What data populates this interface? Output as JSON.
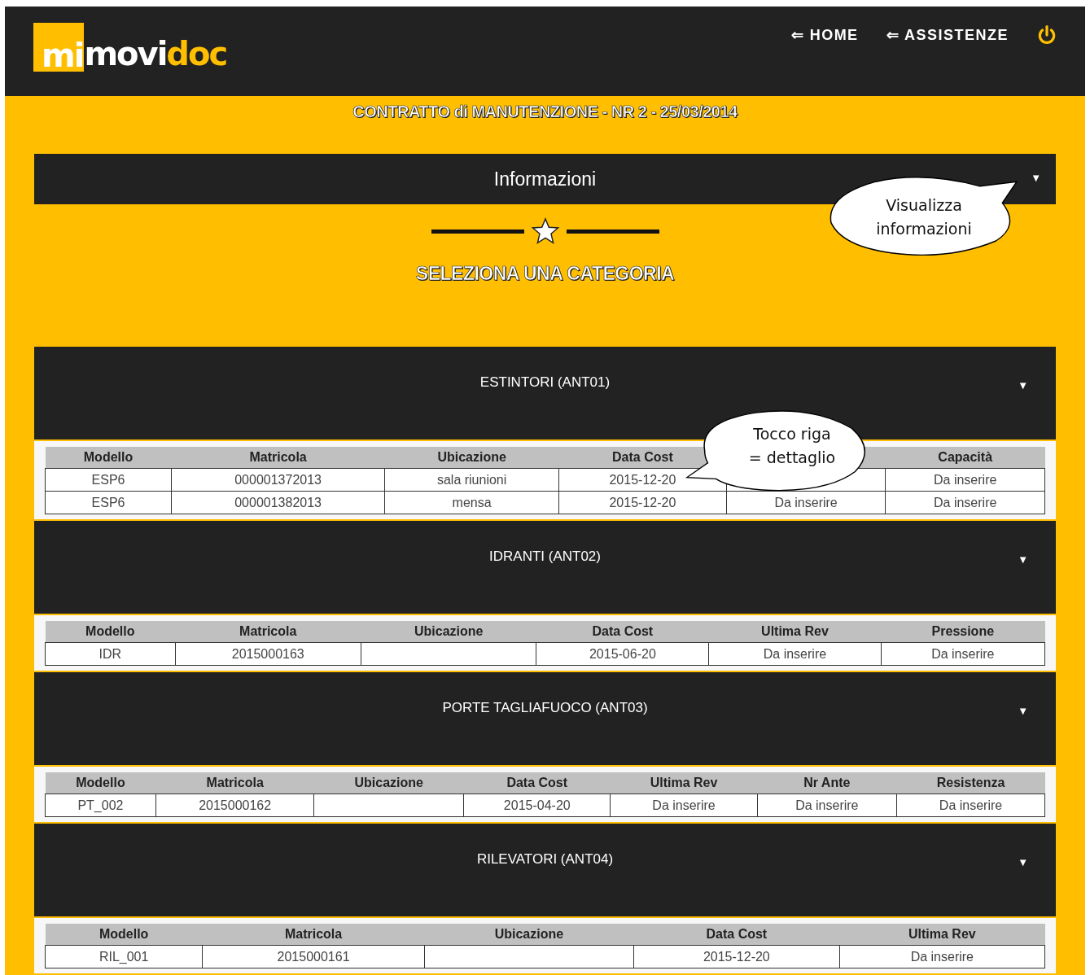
{
  "header": {
    "logo": [
      {
        "text": "mi",
        "kind": "boxed"
      },
      {
        "text": "movi",
        "kind": "plain"
      },
      {
        "text": "doc",
        "kind": "accent"
      }
    ],
    "nav": [
      {
        "arrow": "⇐",
        "label": "HOME"
      },
      {
        "arrow": "⇐",
        "label": "ASSISTENZE"
      }
    ]
  },
  "title": "CONTRATTO di MANUTENZIONE - NR 2 - 25/03/2014",
  "info_panel": {
    "label": "Informazioni",
    "expanded": false,
    "caret": "▼"
  },
  "section_title": "SELEZIONA UNA CATEGORIA",
  "categories": [
    {
      "label": "ESTINTORI (ANT01)",
      "caret": "▼",
      "columns": [
        "Modello",
        "Matricola",
        "Ubicazione",
        "Data Cost",
        null,
        "Capacità"
      ],
      "rows": [
        [
          "ESP6",
          "000001372013",
          "sala riunioni",
          "2015-12-20",
          null,
          "Da inserire"
        ],
        [
          "ESP6",
          "000001382013",
          "mensa",
          "2015-12-20",
          "Da inserire",
          "Da inserire"
        ]
      ]
    },
    {
      "label": "IDRANTI (ANT02)",
      "caret": "▼",
      "columns": [
        "Modello",
        "Matricola",
        "Ubicazione",
        "Data Cost",
        "Ultima Rev",
        "Pressione"
      ],
      "rows": [
        [
          "IDR",
          "2015000163",
          "",
          "2015-06-20",
          "Da inserire",
          "Da inserire"
        ]
      ]
    },
    {
      "label": "PORTE TAGLIAFUOCO (ANT03)",
      "caret": "▼",
      "columns": [
        "Modello",
        "Matricola",
        "Ubicazione",
        "Data Cost",
        "Ultima Rev",
        "Nr Ante",
        "Resistenza"
      ],
      "rows": [
        [
          "PT_002",
          "2015000162",
          "",
          "2015-04-20",
          "Da inserire",
          "Da inserire",
          "Da inserire"
        ]
      ]
    },
    {
      "label": "RILEVATORI (ANT04)",
      "caret": "▼",
      "columns": [
        "Modello",
        "Matricola",
        "Ubicazione",
        "Data Cost",
        "Ultima Rev"
      ],
      "rows": [
        [
          "RIL_001",
          "2015000161",
          "",
          "2015-12-20",
          "Da inserire"
        ]
      ]
    }
  ],
  "callouts": [
    {
      "kind": "info",
      "lines": [
        "Visualizza",
        "informazioni"
      ]
    },
    {
      "kind": "row",
      "lines": [
        "Tocco riga",
        "= dettaglio"
      ]
    }
  ]
}
